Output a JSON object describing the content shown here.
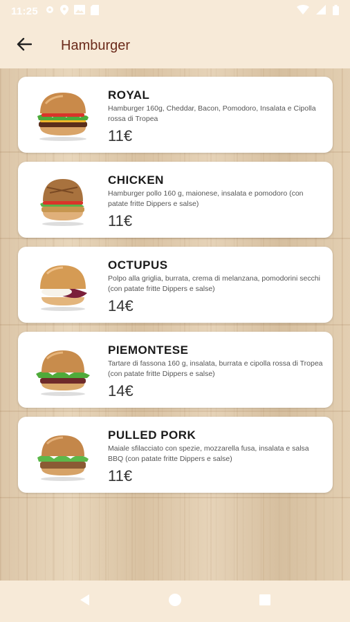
{
  "status_bar": {
    "time": "11:25"
  },
  "app_bar": {
    "title": "Hamburger"
  },
  "items": [
    {
      "name": "ROYAL",
      "description": "Hamburger 160g, Cheddar, Bacon, Pomodoro, Insalata e Cipolla rossa di Tropea",
      "price": "11€"
    },
    {
      "name": "CHICKEN",
      "description": "Hamburger pollo 160 g, maionese, insalata e pomodoro (con patate fritte Dippers e salse)",
      "price": "11€"
    },
    {
      "name": "OCTUPUS",
      "description": "Polpo alla griglia, burrata, crema di melanzana, pomodorini secchi  (con patate fritte Dippers e salse)",
      "price": "14€"
    },
    {
      "name": "PIEMONTESE",
      "description": "Tartare di fassona 160 g, insalata, burrata e cipolla rossa di Tropea  (con patate fritte Dippers e salse)",
      "price": "14€"
    },
    {
      "name": "PULLED PORK",
      "description": "Maiale sfilacciato con spezie, mozzarella fusa, insalata e salsa BBQ  (con patate fritte Dippers e salse)",
      "price": "11€"
    }
  ],
  "icons": {
    "status_left": [
      "gear-icon",
      "location-icon",
      "image-icon",
      "sd-card-icon"
    ],
    "status_right": [
      "wifi-icon",
      "signal-icon",
      "battery-icon"
    ],
    "back": "arrow-left-icon",
    "nav": [
      "back-triangle-icon",
      "home-circle-icon",
      "recents-square-icon"
    ]
  },
  "colors": {
    "title": "#6b2a1a",
    "app_bar": "#f7ead8"
  }
}
